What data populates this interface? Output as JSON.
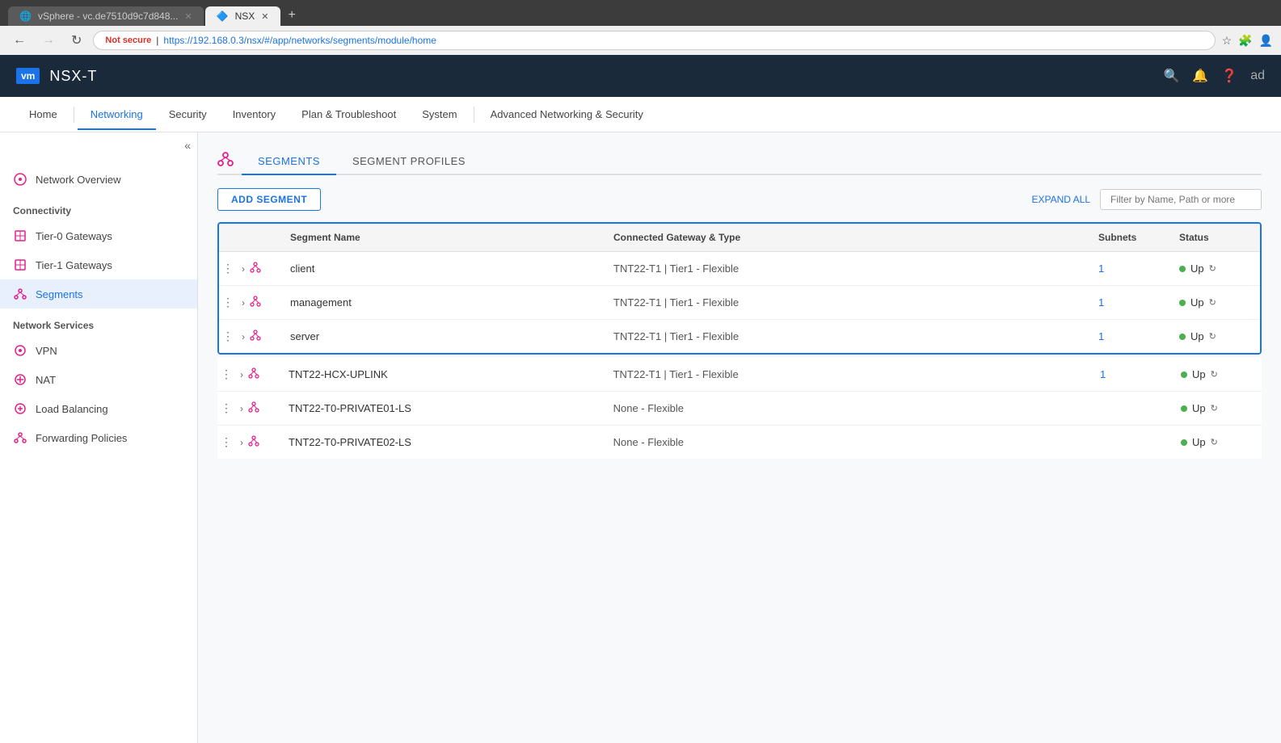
{
  "browser": {
    "tabs": [
      {
        "id": "vsphere",
        "label": "vSphere - vc.de7510d9c7d848...",
        "active": false,
        "favicon": "🌐"
      },
      {
        "id": "nsx",
        "label": "NSX",
        "active": true,
        "favicon": "🔷"
      }
    ],
    "address": "https://192.168.0.3/nsx/#/app/networks/segments/module/home",
    "not_secure_label": "Not secure"
  },
  "app": {
    "logo_text": "vm",
    "name": "NSX-T"
  },
  "nav": {
    "items": [
      {
        "id": "home",
        "label": "Home",
        "active": false
      },
      {
        "id": "networking",
        "label": "Networking",
        "active": true
      },
      {
        "id": "security",
        "label": "Security",
        "active": false
      },
      {
        "id": "inventory",
        "label": "Inventory",
        "active": false
      },
      {
        "id": "plan",
        "label": "Plan & Troubleshoot",
        "active": false
      },
      {
        "id": "system",
        "label": "System",
        "active": false
      },
      {
        "id": "advanced",
        "label": "Advanced Networking & Security",
        "active": false
      }
    ]
  },
  "sidebar": {
    "sections": [
      {
        "id": "overview",
        "items": [
          {
            "id": "network-overview",
            "label": "Network Overview",
            "icon": "⊙"
          }
        ]
      },
      {
        "id": "connectivity",
        "title": "Connectivity",
        "items": [
          {
            "id": "tier0",
            "label": "Tier-0 Gateways",
            "icon": "⊞"
          },
          {
            "id": "tier1",
            "label": "Tier-1 Gateways",
            "icon": "⊞"
          },
          {
            "id": "segments",
            "label": "Segments",
            "icon": "✦",
            "active": true
          }
        ]
      },
      {
        "id": "network-services",
        "title": "Network Services",
        "items": [
          {
            "id": "vpn",
            "label": "VPN",
            "icon": "⊙"
          },
          {
            "id": "nat",
            "label": "NAT",
            "icon": "⊕"
          },
          {
            "id": "load-balancing",
            "label": "Load Balancing",
            "icon": "⊛"
          },
          {
            "id": "forwarding-policies",
            "label": "Forwarding Policies",
            "icon": "✦"
          }
        ]
      }
    ]
  },
  "content": {
    "tabs": [
      {
        "id": "segments",
        "label": "SEGMENTS",
        "active": true
      },
      {
        "id": "segment-profiles",
        "label": "SEGMENT PROFILES",
        "active": false
      }
    ],
    "add_button": "ADD SEGMENT",
    "expand_all": "EXPAND ALL",
    "filter_placeholder": "Filter by Name, Path or more",
    "table": {
      "headers": [
        {
          "id": "actions",
          "label": ""
        },
        {
          "id": "name",
          "label": "Segment Name"
        },
        {
          "id": "gateway",
          "label": "Connected Gateway & Type"
        },
        {
          "id": "subnets",
          "label": "Subnets"
        },
        {
          "id": "status",
          "label": "Status"
        }
      ],
      "rows_highlighted": [
        {
          "id": "client",
          "name": "client",
          "gateway": "TNT22-T1 | Tier1 - Flexible",
          "subnets": "1",
          "status": "Up"
        },
        {
          "id": "management",
          "name": "management",
          "gateway": "TNT22-T1 | Tier1 - Flexible",
          "subnets": "1",
          "status": "Up"
        },
        {
          "id": "server",
          "name": "server",
          "gateway": "TNT22-T1 | Tier1 - Flexible",
          "subnets": "1",
          "status": "Up"
        }
      ],
      "rows_plain": [
        {
          "id": "tnt22-hcx",
          "name": "TNT22-HCX-UPLINK",
          "gateway": "TNT22-T1 | Tier1 - Flexible",
          "subnets": "1",
          "status": "Up"
        },
        {
          "id": "tnt22-private01",
          "name": "TNT22-T0-PRIVATE01-LS",
          "gateway": "None - Flexible",
          "subnets": "",
          "status": "Up"
        },
        {
          "id": "tnt22-private02",
          "name": "TNT22-T0-PRIVATE02-LS",
          "gateway": "None - Flexible",
          "subnets": "",
          "status": "Up"
        }
      ]
    }
  }
}
